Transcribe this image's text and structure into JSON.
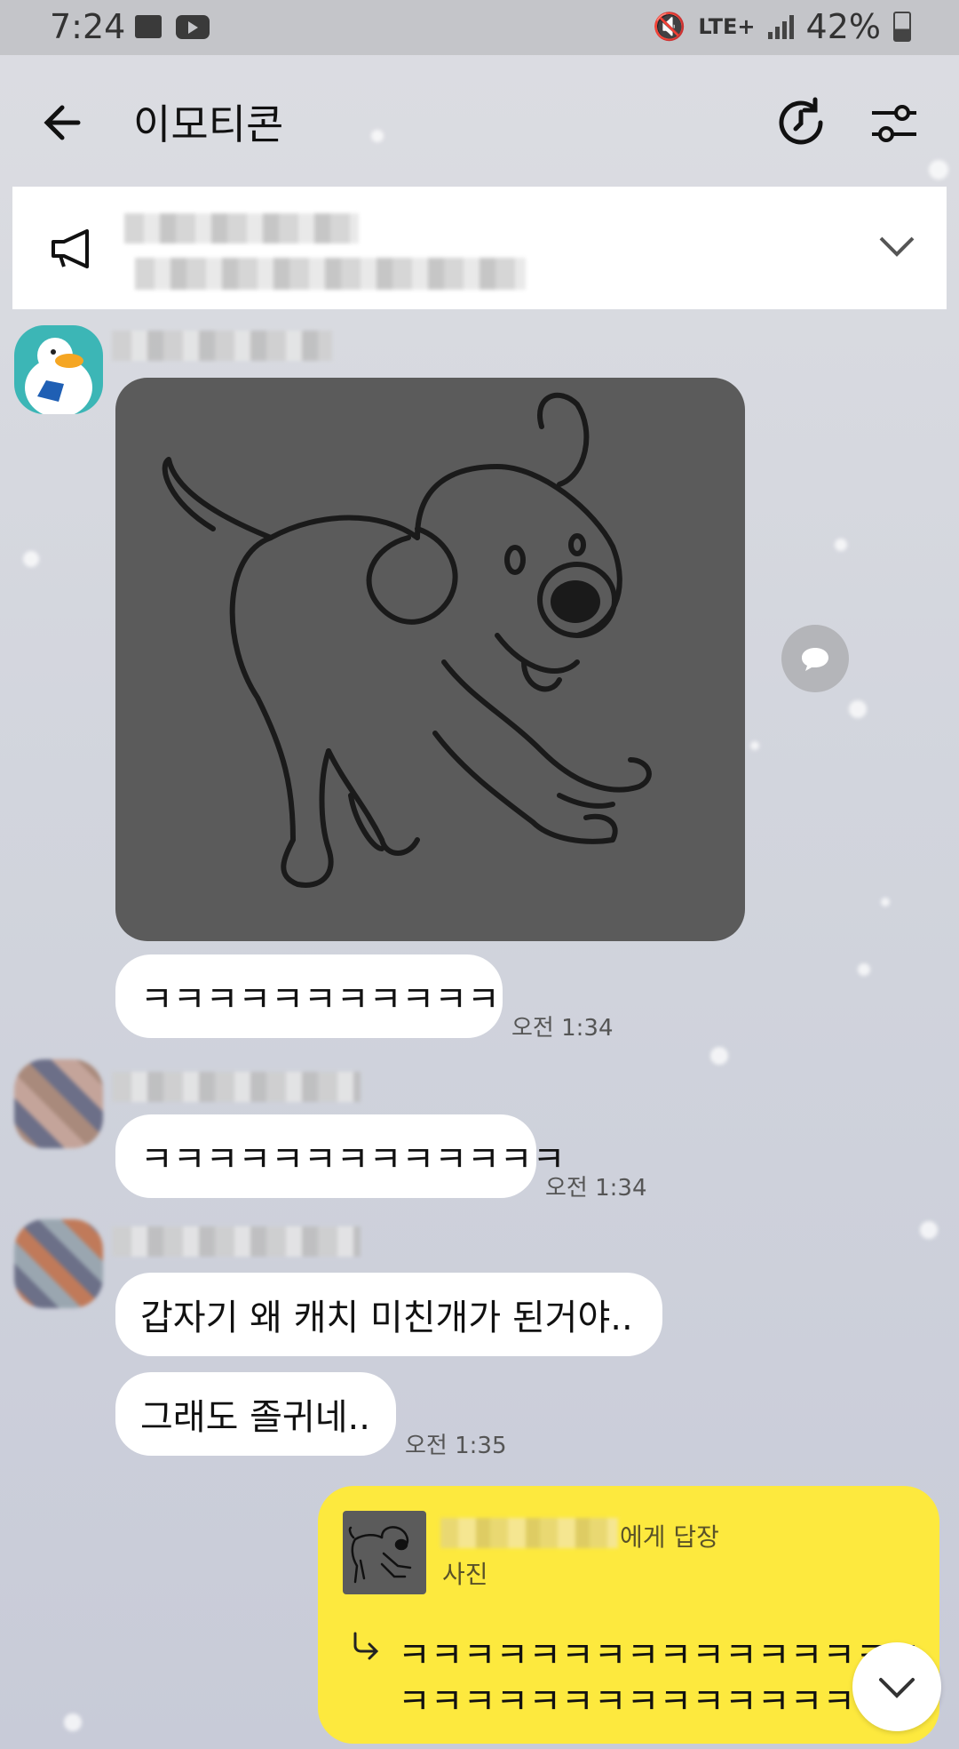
{
  "status_bar": {
    "time": "7:24",
    "network": "LTE+",
    "battery": "42%"
  },
  "header": {
    "title": "이모티콘"
  },
  "messages": [
    {
      "text": "ㅋㅋㅋㅋㅋㅋㅋㅋㅋㅋㅋ",
      "time": "오전 1:34"
    },
    {
      "text": "ㅋㅋㅋㅋㅋㅋㅋㅋㅋㅋㅋㅋㅋ",
      "time": "오전 1:34"
    },
    {
      "text": "갑자기 왜 캐치 미친개가 된거야.."
    },
    {
      "text": "그래도 졸귀네..",
      "time": "오전 1:35"
    }
  ],
  "reply": {
    "to_suffix": "에게 답장",
    "type": "사진",
    "line1": "ㅋㅋㅋㅋㅋㅋㅋㅋㅋㅋㅋㅋㅋㅋㅋㅋ",
    "line2": "ㅋㅋㅋㅋㅋㅋㅋㅋㅋㅋㅋㅋㅋㅋ"
  },
  "colors": {
    "reply_bg": "#fde93e",
    "sticker_bg": "#5b5b5b"
  }
}
